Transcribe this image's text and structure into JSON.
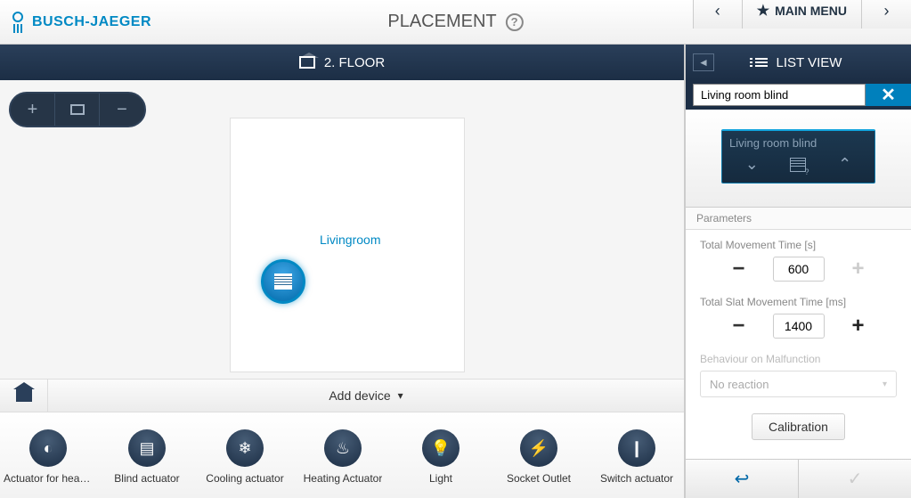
{
  "brand": "BUSCH-JAEGER",
  "page_title": "PLACEMENT",
  "header": {
    "main_menu": "MAIN MENU"
  },
  "floor": {
    "label": "2. FLOOR"
  },
  "canvas": {
    "room_label": "Livingroom"
  },
  "toolbar": {
    "add_device": "Add device"
  },
  "devices": [
    {
      "key": "actuator-heating",
      "label": "Actuator for heati…",
      "icon": "◐"
    },
    {
      "key": "blind-actuator",
      "label": "Blind actuator",
      "icon": "▤"
    },
    {
      "key": "cooling-actuator",
      "label": "Cooling actuator",
      "icon": "❄"
    },
    {
      "key": "heating-actuator",
      "label": "Heating Actuator",
      "icon": "♨"
    },
    {
      "key": "light",
      "label": "Light",
      "icon": "💡"
    },
    {
      "key": "socket-outlet",
      "label": "Socket Outlet",
      "icon": "⚡"
    },
    {
      "key": "switch-actuator",
      "label": "Switch actuator",
      "icon": "❙"
    }
  ],
  "right": {
    "list_view": "LIST VIEW",
    "search_value": "Living room blind",
    "card": {
      "name": "Living room blind"
    },
    "params_header": "Parameters",
    "param1": {
      "label": "Total Movement Time [s]",
      "value": "600"
    },
    "param2": {
      "label": "Total Slat Movement Time [ms]",
      "value": "1400"
    },
    "param3": {
      "label": "Behaviour on Malfunction",
      "value": "No reaction"
    },
    "calibration": "Calibration"
  }
}
